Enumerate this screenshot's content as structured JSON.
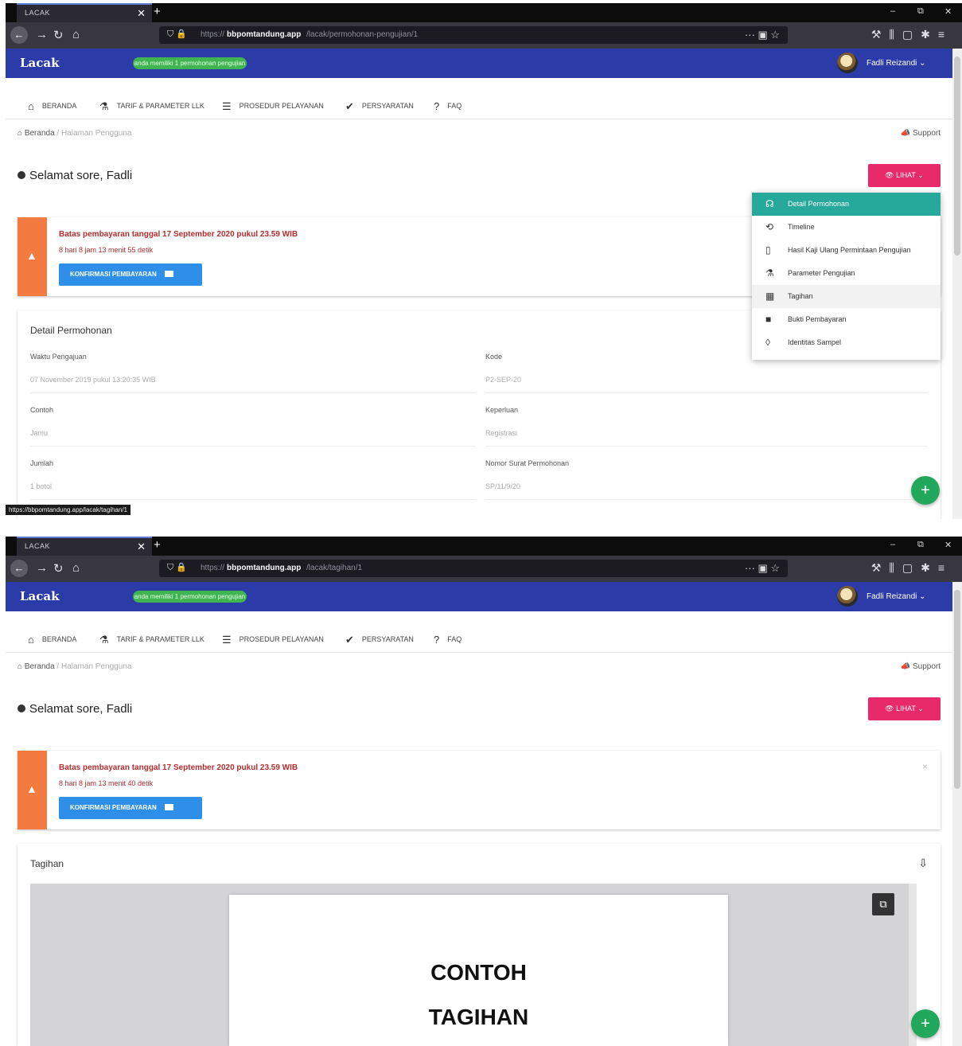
{
  "browser": {
    "tab_title": "LACAK",
    "tab_close": "✕",
    "new_tab": "+",
    "window_controls": [
      "–",
      "⧉",
      "✕"
    ],
    "url_protocol": "https://",
    "url_domain": "bbpomtandung.app",
    "url_path_1": "/lacak/permohonan-pengujian/1",
    "url_path_2": "/lacak/tagihan/1",
    "status_link": "https://bbpomtandung.app/lacak/tagihan/1"
  },
  "appbar": {
    "logo_text": "Lacak",
    "status_pill": "anda memiliki 1 permohonan pengujian",
    "user_name": "Fadli Reizandi"
  },
  "menu": {
    "items": [
      "BERANDA",
      "TARIF & PARAMETER LLK",
      "PROSEDUR PELAYANAN",
      "PERSYARATAN",
      "FAQ"
    ]
  },
  "breadcrumb": {
    "home": "Beranda",
    "separator": "/",
    "current": "Halaman Pengguna"
  },
  "support_label": "Support",
  "greeting": "Selamat sore, Fadli",
  "lihat_button": "LIHAT",
  "alert": {
    "title": "Batas pembayaran tanggal 17 September 2020 pukul 23.59 WIB",
    "countdown_1": "8 hari 8 jam 13 menit 55 detik",
    "countdown_2": "8 hari 8 jam 13 menit 40 detik",
    "confirm_button": "KONFIRMASI PEMBAYARAN",
    "close": "×"
  },
  "dropdown": {
    "items": [
      {
        "icon": "headset-icon",
        "label": "Detail Permohonan"
      },
      {
        "icon": "history-icon",
        "label": "Timeline"
      },
      {
        "icon": "file-icon",
        "label": "Hasil Kaji Ulang Permintaan Pengujian"
      },
      {
        "icon": "flask-icon",
        "label": "Parameter Pengujian"
      },
      {
        "icon": "invoice-icon",
        "label": "Tagihan"
      },
      {
        "icon": "money-icon",
        "label": "Bukti Pembayaran"
      },
      {
        "icon": "bottle-icon",
        "label": "Identitas Sampel"
      }
    ]
  },
  "detail": {
    "title": "Detail Permohonan",
    "fields": [
      {
        "label": "Waktu Pengajuan",
        "value": "07 November 2019 pukul 13:20:35 WIB"
      },
      {
        "label": "Kode",
        "value": "P2-SEP-20"
      },
      {
        "label": "Contoh",
        "value": "Jamu"
      },
      {
        "label": "Keperluan",
        "value": "Registrasi"
      },
      {
        "label": "Jumlah",
        "value": "1 botol"
      },
      {
        "label": "Nomor Surat Permohonan",
        "value": "SP/11/9/20"
      }
    ]
  },
  "tagihan": {
    "title": "Tagihan",
    "doc_line1": "CONTOH",
    "doc_line2": "TAGIHAN"
  },
  "fab_label": "+",
  "colors": {
    "appbar": "#2b3ba8",
    "accent_pink": "#e82a6a",
    "alert_orange": "#f47b3f",
    "confirm_blue": "#2e8fe8",
    "dropdown_active": "#26a89a",
    "fab_green": "#22a85d"
  }
}
